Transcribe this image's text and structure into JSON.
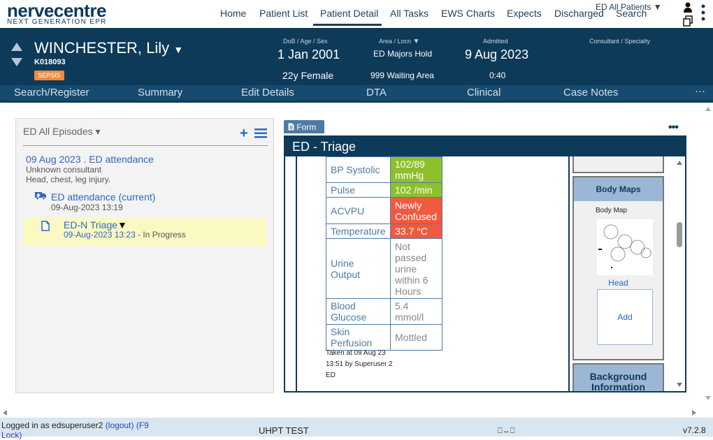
{
  "logo": {
    "main": "nervecentre",
    "sub": "NEXT GENERATION EPR"
  },
  "nav": {
    "items": [
      "Home",
      "Patient List",
      "Patient Detail",
      "All Tasks",
      "EWS Charts",
      "Expects",
      "Discharged",
      "Search"
    ],
    "active": "Patient Detail",
    "patients_filter": "ED All Patients ▼"
  },
  "patient": {
    "name": "WINCHESTER, Lily",
    "dropdown": "▼",
    "id": "K018093",
    "alert": "SEPSIS",
    "dob_label": "DoB / Age / Sex",
    "dob": "1 Jan 2001",
    "age_sex": "22y Female",
    "area_label": "Area / Locn",
    "area": "ED Majors Hold",
    "locn": "999 Waiting Area",
    "admitted_label": "Admitted",
    "admitted": "9 Aug 2023",
    "admitted_time": "0:40",
    "consultant_label": "Consultant / Specialty"
  },
  "subnav": {
    "items": [
      "Search/Register",
      "Summary",
      "Edit Details",
      "DTA",
      "Clinical",
      "Case Notes"
    ],
    "more": "···"
  },
  "episodes": {
    "header": "ED All Episodes ▾",
    "plus": "+",
    "attendance_date": "09 Aug 2023 . ED attendance",
    "consultant": "Unknown consultant",
    "complaint": "Head, chest, leg injury.",
    "attendance_link": "ED attendance (current)",
    "attendance_time": "09-Aug-2023 13:19",
    "triage_link": "ED-N Triage",
    "triage_arrow": "▼",
    "triage_time": "09-Aug-2023 13:23",
    "triage_status": " - In Progress"
  },
  "form": {
    "tab": "Form",
    "title": "ED - Triage",
    "more": "•••",
    "observations": [
      {
        "label": "BP Systolic",
        "value": "102/89 mmHg",
        "status": "green"
      },
      {
        "label": "Pulse",
        "value": "102 /min",
        "status": "green"
      },
      {
        "label": "ACVPU",
        "value": "Newly Confused",
        "status": "red"
      },
      {
        "label": "Temperature",
        "value": "33.7 °C",
        "status": "red"
      },
      {
        "label": "Urine Output",
        "value": "Not passed urine within 6 Hours",
        "status": "white"
      },
      {
        "label": "Blood Glucose",
        "value": "5.4 mmol/l",
        "status": "white"
      },
      {
        "label": "Skin Perfusion",
        "value": "Mottled",
        "status": "white"
      }
    ],
    "taken_line1": "Taken at 09 Aug 23",
    "taken_line2": "13:51 by Superuser 2",
    "taken_line3": "ED",
    "body_maps_title": "Body Maps",
    "body_map_label": "Body Map",
    "head_link": "Head",
    "add_link": "Add",
    "background_title": "Background Information"
  },
  "footer": {
    "logged_in": "Logged in as edsuperuser2",
    "logout": "(logout)",
    "lock1": "(F9",
    "lock2": "Lock)",
    "env": "UHPT TEST",
    "screens": "⎕↔⎕",
    "version": "v7.2.8"
  },
  "colors": {
    "banner": "#0d3a58",
    "subnav": "#164a6e",
    "link": "#2b66c4",
    "green": "#8ec02d",
    "red": "#f05a40",
    "sepsis": "#f08a3c"
  }
}
